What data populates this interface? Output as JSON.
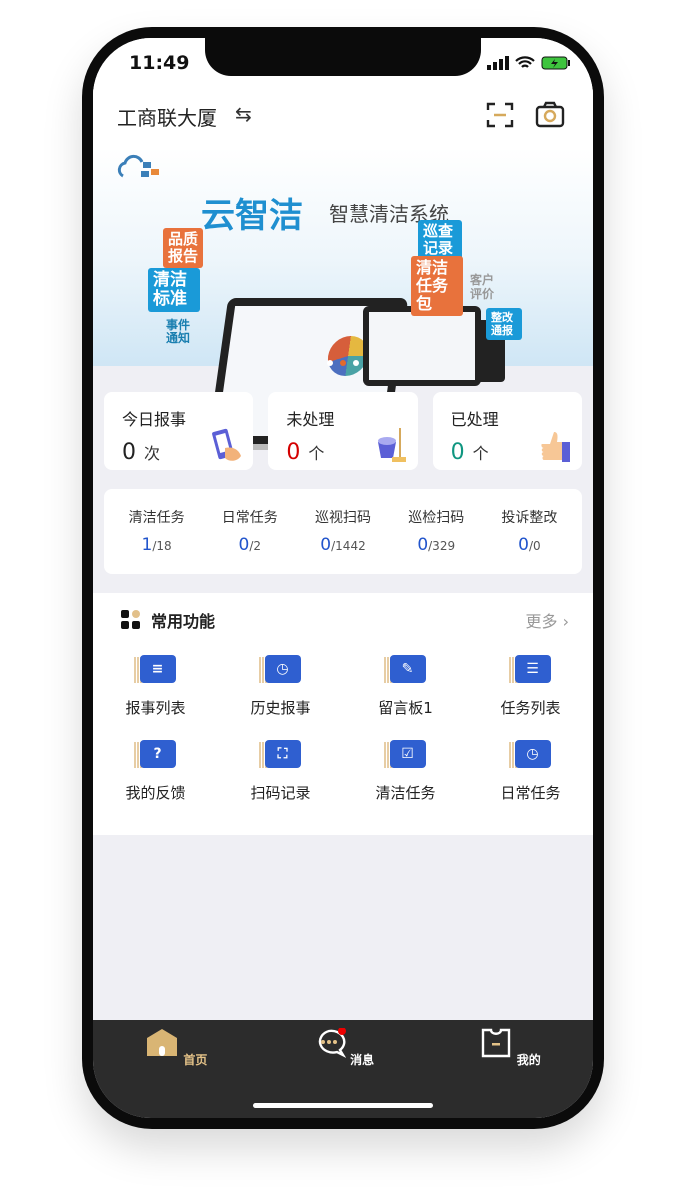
{
  "status": {
    "time": "11:49"
  },
  "header": {
    "title": "工商联大厦",
    "swap_icon": "swap-arrows-icon",
    "scan_icon": "scan-icon",
    "camera_icon": "camera-icon"
  },
  "banner": {
    "title": "云智洁",
    "subtitle": "智慧清洁系统",
    "tags": [
      "品质报告",
      "清洁标准",
      "事件通知",
      "巡查记录",
      "清洁任务包",
      "客户评价",
      "整改通报"
    ],
    "active_slide": 2,
    "slide_count": 3
  },
  "stats": [
    {
      "label": "今日报事",
      "value": "0",
      "unit": "次",
      "color": "#222222"
    },
    {
      "label": "未处理",
      "value": "0",
      "unit": "个",
      "color": "#d40000"
    },
    {
      "label": "已处理",
      "value": "0",
      "unit": "个",
      "color": "#0f9680"
    }
  ],
  "tasks": [
    {
      "label": "清洁任务",
      "done": "1",
      "total": "/18"
    },
    {
      "label": "日常任务",
      "done": "0",
      "total": "/2"
    },
    {
      "label": "巡视扫码",
      "done": "0",
      "total": "/1442"
    },
    {
      "label": "巡检扫码",
      "done": "0",
      "total": "/329"
    },
    {
      "label": "投诉整改",
      "done": "0",
      "total": "/0"
    }
  ],
  "functions": {
    "title": "常用功能",
    "more": "更多",
    "items": [
      {
        "label": "报事列表",
        "glyph": "≡"
      },
      {
        "label": "历史报事",
        "glyph": "◷"
      },
      {
        "label": "留言板1",
        "glyph": "✎"
      },
      {
        "label": "任务列表",
        "glyph": "☰"
      },
      {
        "label": "我的反馈",
        "glyph": "?"
      },
      {
        "label": "扫码记录",
        "glyph": "⛶"
      },
      {
        "label": "清洁任务",
        "glyph": "☑"
      },
      {
        "label": "日常任务",
        "glyph": "◷"
      }
    ]
  },
  "tabbar": [
    {
      "label": "首页",
      "active": true
    },
    {
      "label": "消息",
      "badge": true
    },
    {
      "label": "我的"
    }
  ],
  "colors": {
    "accent": "#2f5fd0",
    "tab_active": "#e4c288",
    "tabbar_bg": "#2c2c2c"
  }
}
